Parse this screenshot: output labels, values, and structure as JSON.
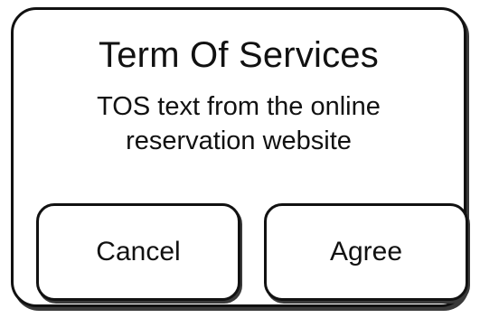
{
  "dialog": {
    "title": "Term Of Services",
    "body": "TOS text from the online\nreservation website",
    "buttons": {
      "cancel_label": "Cancel",
      "agree_label": "Agree"
    }
  }
}
